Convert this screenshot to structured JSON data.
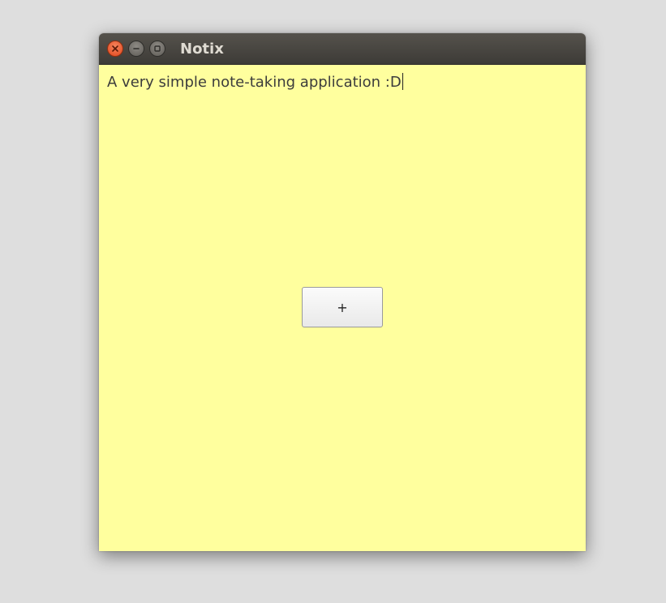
{
  "window": {
    "title": "Notix"
  },
  "note": {
    "text": "A very simple note-taking application :D"
  },
  "add_button": {
    "label": "+"
  },
  "colors": {
    "desktop": "#dedede",
    "titlebar": "#46443f",
    "note_background": "#ffff9e",
    "close_button": "#e95420"
  },
  "icons": {
    "close": "close-icon",
    "minimize": "minimize-icon",
    "maximize": "maximize-icon"
  }
}
